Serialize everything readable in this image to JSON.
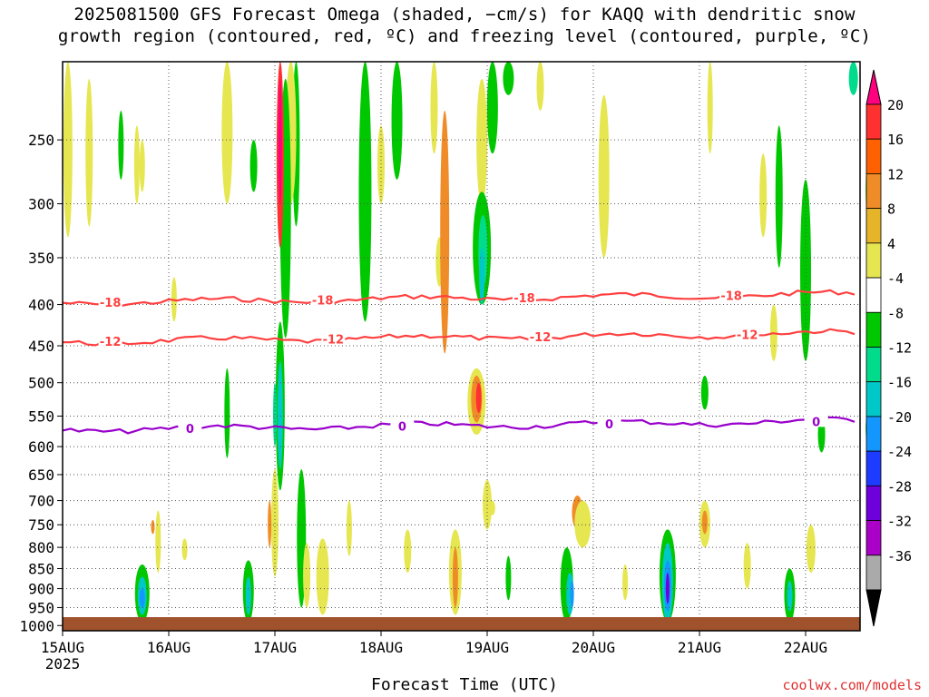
{
  "title": {
    "line1": "2025081500 GFS Forecast Omega (shaded, −cm/s) for KAQQ with dendritic snow",
    "line2": "growth region (contoured, red, ºC) and freezing level (contoured, purple, ºC)"
  },
  "credit": "coolwx.com/models",
  "chart_data": {
    "type": "heatmap",
    "title": "2025081500 GFS Forecast Omega (shaded, −cm/s) for KAQQ with dendritic snow growth region (contoured, red, ºC) and freezing level (contoured, purple, ºC)",
    "xlabel": "Forecast Time (UTC)",
    "ylabel": "",
    "x_ticks": [
      "15AUG",
      "16AUG",
      "17AUG",
      "18AUG",
      "19AUG",
      "20AUG",
      "21AUG",
      "22AUG"
    ],
    "x_year": "2025",
    "xlim_days": [
      0,
      7.5
    ],
    "y_ticks": [
      250,
      300,
      350,
      400,
      450,
      500,
      550,
      600,
      650,
      700,
      750,
      800,
      850,
      900,
      950,
      1000
    ],
    "ylim_hpa": [
      200,
      1015
    ],
    "y_scale": "log",
    "grid": true,
    "colorbar": {
      "labels": [
        20,
        16,
        12,
        8,
        4,
        -4,
        -8,
        -12,
        -16,
        -20,
        -24,
        -28,
        -32,
        -36
      ],
      "colors": [
        "#ff007f",
        "#ff3030",
        "#ff6000",
        "#f08c28",
        "#e6b428",
        "#e6e650",
        "#ffffff",
        "#00c800",
        "#00dc8c",
        "#00c8c8",
        "#1496ff",
        "#1e3cff",
        "#6e00dc",
        "#aa00c8",
        "#aaaaaa",
        "#000000"
      ]
    },
    "contours": [
      {
        "name": "-18",
        "color": "#ff4040",
        "level_hpa": 398,
        "labels_at_day": [
          0.45,
          2.45,
          4.35,
          6.3
        ]
      },
      {
        "name": "-12",
        "color": "#ff4040",
        "level_hpa": 445,
        "labels_at_day": [
          0.45,
          2.55,
          4.5,
          6.45
        ]
      },
      {
        "name": "0",
        "color": "#9900cc",
        "level_hpa": 572,
        "labels_at_day": [
          1.2,
          3.2,
          5.15,
          7.1
        ]
      }
    ],
    "terrain_color": "#a0522d"
  }
}
